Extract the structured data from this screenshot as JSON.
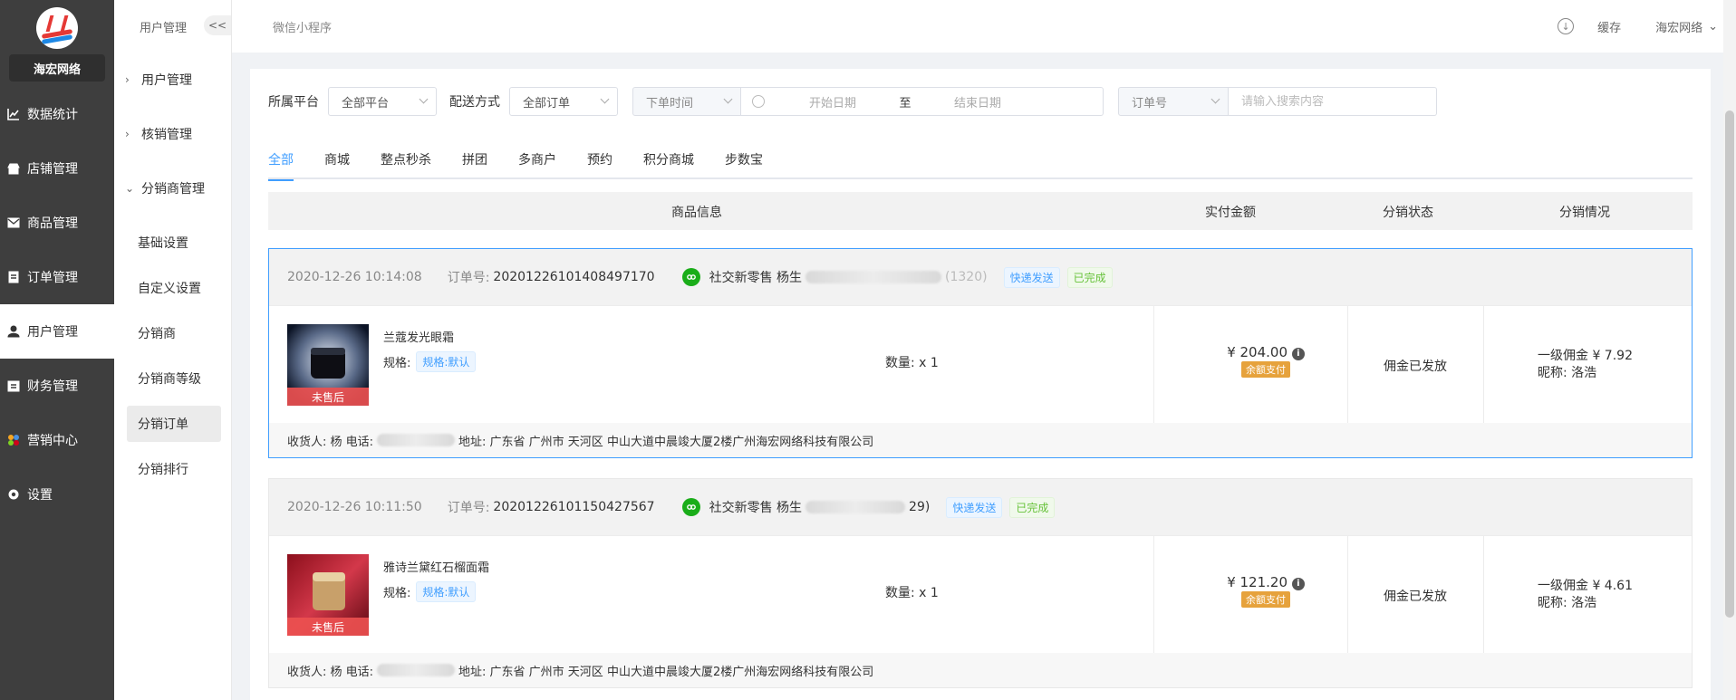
{
  "brand": {
    "name": "海宏网络"
  },
  "nav": [
    {
      "label": "数据统计",
      "icon": "chart-line-icon"
    },
    {
      "label": "店铺管理",
      "icon": "shop-icon"
    },
    {
      "label": "商品管理",
      "icon": "mail-icon"
    },
    {
      "label": "订单管理",
      "icon": "order-list-icon"
    },
    {
      "label": "用户管理",
      "icon": "user-icon",
      "active": true
    },
    {
      "label": "财务管理",
      "icon": "finance-icon"
    },
    {
      "label": "营销中心",
      "icon": "marketing-icon"
    },
    {
      "label": "设置",
      "icon": "settings-icon"
    }
  ],
  "subnav": {
    "title": "用户管理",
    "collapse": "<<",
    "groups": [
      {
        "label": "用户管理",
        "chevron": "›"
      },
      {
        "label": "核销管理",
        "chevron": "›"
      },
      {
        "label": "分销商管理",
        "chevron": "⌄"
      }
    ],
    "items": [
      {
        "label": "基础设置"
      },
      {
        "label": "自定义设置"
      },
      {
        "label": "分销商"
      },
      {
        "label": "分销商等级"
      },
      {
        "label": "分销订单",
        "active": true
      },
      {
        "label": "分销排行"
      }
    ]
  },
  "header": {
    "title": "微信小程序",
    "cache": "缓存",
    "user": "海宏网络",
    "user_caret": "⌄"
  },
  "filters": {
    "platform_label": "所属平台",
    "platform_value": "全部平台",
    "delivery_label": "配送方式",
    "delivery_value": "全部订单",
    "time_type": "下单时间",
    "start_placeholder": "开始日期",
    "range_sep": "至",
    "end_placeholder": "结束日期",
    "search_type": "订单号",
    "search_placeholder": "请输入搜索内容"
  },
  "tabs": [
    "全部",
    "商城",
    "整点秒杀",
    "拼团",
    "多商户",
    "预约",
    "积分商城",
    "步数宝"
  ],
  "table_headers": {
    "product": "商品信息",
    "paid": "实付金额",
    "status": "分销状态",
    "detail": "分销情况"
  },
  "orders": [
    {
      "time": "2020-12-26 10:14:08",
      "no_label": "订单号:",
      "no": "20201226101408497170",
      "shop": "社交新零售 杨生",
      "shop_tail": "(1320)",
      "tags": [
        "快递发送",
        "已完成"
      ],
      "product": "兰蔻发光眼霜",
      "spec_label": "规格:",
      "spec": "规格:默认",
      "after_sale": "未售后",
      "qty": "数量:  x 1",
      "price": "¥ 204.00",
      "pay": "余额支付",
      "dist_status": "佣金已发放",
      "commission": "一级佣金 ¥ 7.92",
      "nickname": "昵称:  洛浩",
      "receiver_prefix": "收货人: 杨 电话:",
      "address": "地址: 广东省 广州市 天河区 中山大道中晨竣大厦2楼广州海宏网络科技有限公司"
    },
    {
      "time": "2020-12-26 10:11:50",
      "no_label": "订单号:",
      "no": "20201226101150427567",
      "shop": "社交新零售 杨生",
      "shop_tail": "29)",
      "tags": [
        "快递发送",
        "已完成"
      ],
      "product": "雅诗兰黛红石榴面霜",
      "spec_label": "规格:",
      "spec": "规格:默认",
      "after_sale": "未售后",
      "qty": "数量:  x 1",
      "price": "¥ 121.20",
      "pay": "余额支付",
      "dist_status": "佣金已发放",
      "commission": "一级佣金 ¥ 4.61",
      "nickname": "昵称:  洛浩",
      "receiver_prefix": "收货人: 杨 电话:",
      "address": "地址: 广东省 广州市 天河区 中山大道中晨竣大厦2楼广州海宏网络科技有限公司"
    }
  ]
}
